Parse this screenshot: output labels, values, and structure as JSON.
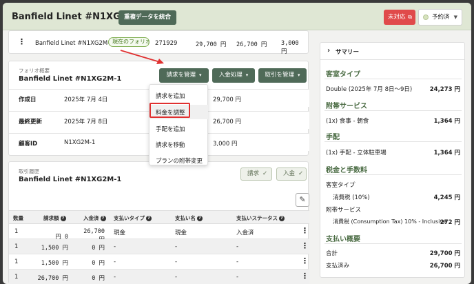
{
  "header": {
    "title": "Banfield Linet #N1XG2M-1",
    "merge_button": "重複データを統合",
    "unpaid_badge": "未対応",
    "status_select": "予約済"
  },
  "top_row": {
    "name": "Banfield Linet #N1XG2M-1",
    "tag": "現在のフォリオ",
    "id": "271929",
    "amount1": "29,700 円",
    "amount2": "26,700 円",
    "amount3": "3,000 円"
  },
  "portfolio": {
    "label": "フォリオ概要",
    "title": "Banfield Linet #N1XG2M-1",
    "btn_manage_bill": "請求を管理",
    "btn_payment": "入金処理",
    "btn_manage_txn": "取引を管理",
    "rows": [
      {
        "label": "作成日",
        "value": "2025年 7月 4日",
        "amount": "29,700 円"
      },
      {
        "label": "最終更新",
        "value": "2025年 7月 8日",
        "amount": "26,700 円"
      },
      {
        "label": "顧客ID",
        "value": "N1XG2M-1",
        "amount": "3,000 円"
      }
    ]
  },
  "dropdown": {
    "items": [
      "請求を追加",
      "料金を調整",
      "手配を追加",
      "請求を移動",
      "プランの附帯変更"
    ]
  },
  "history": {
    "label": "取引履歴",
    "title": "Banfield Linet #N1XG2M-1",
    "btn_bill": "請求",
    "btn_payment": "入金",
    "columns": [
      "数量",
      "請求額",
      "入金済",
      "支払いタイプ",
      "支払い名",
      "支払いステータス"
    ],
    "rows": [
      [
        "1",
        "0 円",
        "26,700 円",
        "現金",
        "現金",
        "入金済"
      ],
      [
        "1",
        "1,500 円",
        "0 円",
        "-",
        "-",
        "-"
      ],
      [
        "1",
        "1,500 円",
        "0 円",
        "-",
        "-",
        "-"
      ],
      [
        "1",
        "26,700 円",
        "0 円",
        "-",
        "-",
        "-"
      ]
    ]
  },
  "summary": {
    "title": "サマリー",
    "room_type": {
      "heading": "客室タイプ",
      "label": "Double (2025年 7月 8日～9日)",
      "value": "24,273 円"
    },
    "services": {
      "heading": "附帯サービス",
      "label": "(1x) 食事 - 朝食",
      "value": "1,364 円"
    },
    "arrangements": {
      "heading": "手配",
      "label": "(1x) 手配 - 立体駐車場",
      "value": "1,364 円"
    },
    "tax": {
      "heading": "税金と手数料",
      "room_label": "客室タイプ",
      "room_tax_label": "消費税 (10%)",
      "room_tax_value": "4,245 円",
      "svc_label": "附帯サービス",
      "svc_tax_label": "消費税 (Consumption Tax) 10% - Inclusive",
      "svc_tax_value": "272 円"
    },
    "payment": {
      "heading": "支払い概要",
      "total_label": "合計",
      "total_value": "29,700 円",
      "paid_label": "支払済み",
      "paid_value": "26,700 円"
    }
  }
}
